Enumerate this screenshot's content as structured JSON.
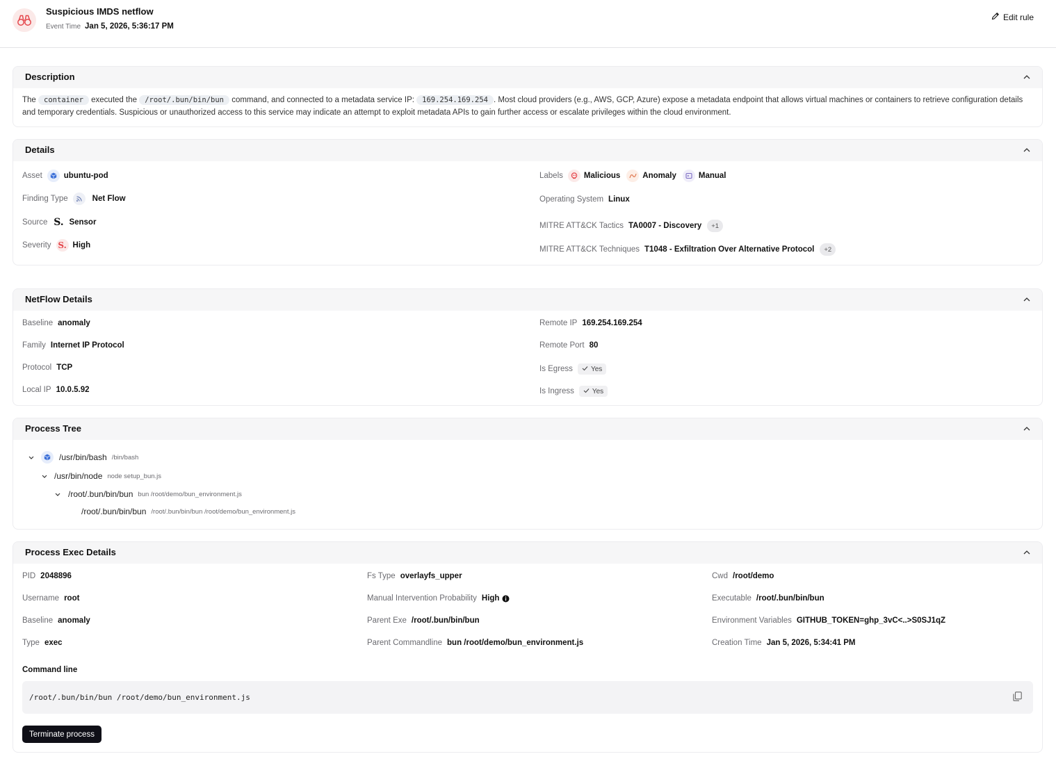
{
  "header": {
    "title": "Suspicious IMDS netflow",
    "event_time_label": "Event Time",
    "event_time_value": "Jan 5, 2026, 5:36:17 PM",
    "edit_rule_label": "Edit rule",
    "icon": "binoculars-icon"
  },
  "description": {
    "title": "Description",
    "text_1": "The",
    "code_1": "container",
    "text_2": "executed the",
    "code_2": "/root/.bun/bin/bun",
    "text_3": "command, and connected to a metadata service IP:",
    "code_3": "169.254.169.254",
    "text_4": ". Most cloud providers (e.g., AWS, GCP, Azure) expose a metadata endpoint that allows virtual machines or containers to retrieve configuration details and temporary credentials. Suspicious or unauthorized access to this service may indicate an attempt to exploit metadata APIs to gain further access or escalate privileges within the cloud environment."
  },
  "details": {
    "title": "Details",
    "asset_label": "Asset",
    "asset_value": "ubuntu-pod",
    "finding_type_label": "Finding Type",
    "finding_type_value": "Net Flow",
    "source_label": "Source",
    "source_value": "Sensor",
    "severity_label": "Severity",
    "severity_value": "High",
    "labels_label": "Labels",
    "labels": [
      "Malicious",
      "Anomaly",
      "Manual"
    ],
    "os_label": "Operating System",
    "os_value": "Linux",
    "tactics_label": "MITRE ATT&CK Tactics",
    "tactics_value": "TA0007 - Discovery",
    "tactics_more": "+1",
    "techniques_label": "MITRE ATT&CK Techniques",
    "techniques_value": "T1048 - Exfiltration Over Alternative Protocol",
    "techniques_more": "+2"
  },
  "netflow": {
    "title": "NetFlow Details",
    "baseline_label": "Baseline",
    "baseline_value": "anomaly",
    "family_label": "Family",
    "family_value": "Internet IP Protocol",
    "protocol_label": "Protocol",
    "protocol_value": "TCP",
    "local_ip_label": "Local IP",
    "local_ip_value": "10.0.5.92",
    "remote_ip_label": "Remote IP",
    "remote_ip_value": "169.254.169.254",
    "remote_port_label": "Remote Port",
    "remote_port_value": "80",
    "egress_label": "Is Egress",
    "egress_value": "Yes",
    "ingress_label": "Is Ingress",
    "ingress_value": "Yes"
  },
  "process_tree": {
    "title": "Process Tree",
    "nodes": [
      {
        "path": "/usr/bin/bash",
        "cmd": "/bin/bash"
      },
      {
        "path": "/usr/bin/node",
        "cmd": "node setup_bun.js"
      },
      {
        "path": "/root/.bun/bin/bun",
        "cmd": "bun /root/demo/bun_environment.js"
      },
      {
        "path": "/root/.bun/bin/bun",
        "cmd": "/root/.bun/bin/bun /root/demo/bun_environment.js"
      }
    ]
  },
  "exec": {
    "title": "Process Exec Details",
    "pid_label": "PID",
    "pid_value": "2048896",
    "username_label": "Username",
    "username_value": "root",
    "baseline_label": "Baseline",
    "baseline_value": "anomaly",
    "type_label": "Type",
    "type_value": "exec",
    "fs_type_label": "Fs Type",
    "fs_type_value": "overlayfs_upper",
    "mip_label": "Manual Intervention Probability",
    "mip_value": "High",
    "parent_exe_label": "Parent Exe",
    "parent_exe_value": "/root/.bun/bin/bun",
    "parent_cmd_label": "Parent Commandline",
    "parent_cmd_value": "bun /root/demo/bun_environment.js",
    "cwd_label": "Cwd",
    "cwd_value": "/root/demo",
    "executable_label": "Executable",
    "executable_value": "/root/.bun/bin/bun",
    "env_label": "Environment Variables",
    "env_value": "GITHUB_TOKEN=ghp_3vC<..>S0SJ1qZ",
    "ctime_label": "Creation Time",
    "ctime_value": "Jan 5, 2026, 5:34:41 PM",
    "cmdline_label": "Command line",
    "cmdline_value": "/root/.bun/bin/bun /root/demo/bun_environment.js",
    "terminate_label": "Terminate process"
  },
  "colors": {
    "accent_red": "#e5484d",
    "asset_blue": "#3b6fd8",
    "manual_purple": "#7c6cc4",
    "dark_button": "#0f0f17"
  }
}
